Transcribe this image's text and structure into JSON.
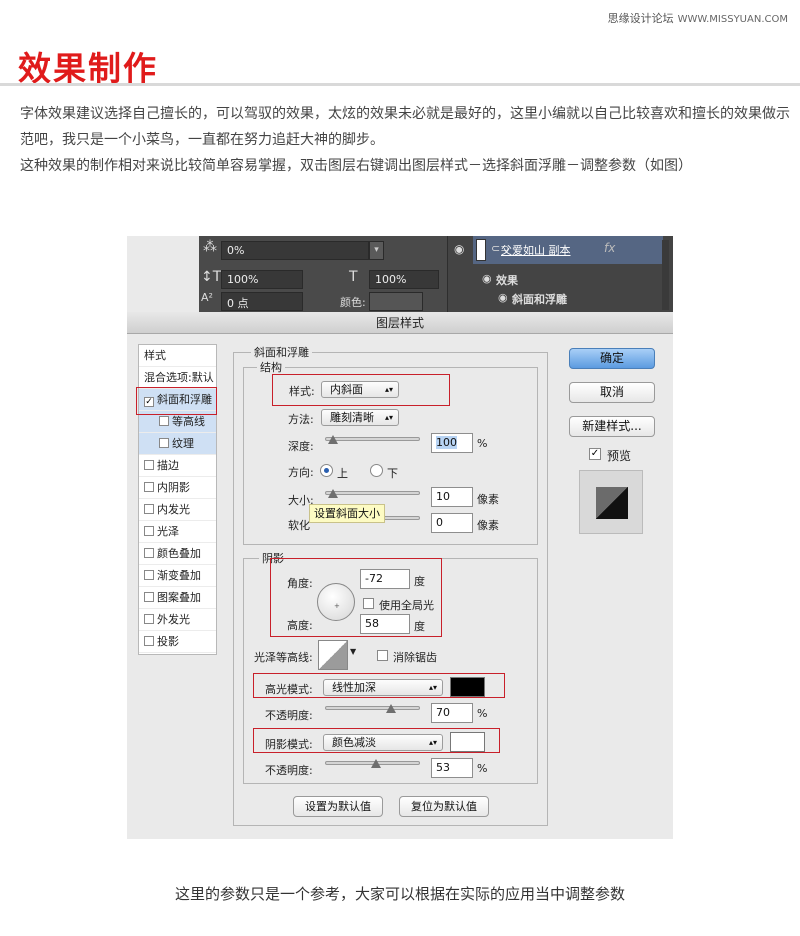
{
  "header": {
    "site_name": "思缘设计论坛",
    "site_url": "WWW.MISSYUAN.COM",
    "title": "效果制作"
  },
  "intro": {
    "p1": "字体效果建议选择自己擅长的，可以驾驭的效果，太炫的效果未必就是最好的，这里小编就以自己比较喜欢和擅长的效果做示范吧，我只是一个小菜鸟，一直都在努力追赶大神的脚步。",
    "p2": "这种效果的制作相对来说比较简单容易掌握，双击图层右键调出图层样式－选择斜面浮雕－调整参数（如图）"
  },
  "caption": "这里的参数只是一个参考，大家可以根据在实际的应用当中调整参数",
  "ps_panel": {
    "fill_value": "0%",
    "vertical_scale": "100%",
    "horizontal_scale": "100%",
    "baseline_value": "0 点",
    "color_label": "颜色:",
    "layer_name": "父爱如山 副本",
    "fx_label": "fx",
    "effects_label": "效果",
    "effect_bevel": "斜面和浮雕"
  },
  "dialog": {
    "title": "图层样式",
    "left_items": [
      {
        "label": "样式"
      },
      {
        "label": "混合选项:默认"
      },
      {
        "label": "斜面和浮雕",
        "checked": true
      },
      {
        "label": "等高线",
        "checked": false
      },
      {
        "label": "纹理",
        "checked": false
      },
      {
        "label": "描边",
        "checked": false
      },
      {
        "label": "内阴影",
        "checked": false
      },
      {
        "label": "内发光",
        "checked": false
      },
      {
        "label": "光泽",
        "checked": false
      },
      {
        "label": "颜色叠加",
        "checked": false
      },
      {
        "label": "渐变叠加",
        "checked": false
      },
      {
        "label": "图案叠加",
        "checked": false
      },
      {
        "label": "外发光",
        "checked": false
      },
      {
        "label": "投影",
        "checked": false
      }
    ],
    "bevel_group": "斜面和浮雕",
    "structure_group": "结构",
    "style_label": "样式:",
    "style_value": "内斜面",
    "technique_label": "方法:",
    "technique_value": "雕刻清晰",
    "depth_label": "深度:",
    "depth_value": "100",
    "depth_unit": "%",
    "direction_label": "方向:",
    "direction_up": "上",
    "direction_down": "下",
    "size_label": "大小:",
    "size_value": "10",
    "size_unit": "像素",
    "soften_label": "软化",
    "soften_value": "0",
    "soften_unit": "像素",
    "tooltip": "设置斜面大小",
    "shading_group": "阴影",
    "angle_label": "角度:",
    "angle_value": "-72",
    "angle_unit": "度",
    "global_light_label": "使用全局光",
    "altitude_label": "高度:",
    "altitude_value": "58",
    "altitude_unit": "度",
    "gloss_contour_label": "光泽等高线:",
    "antialias_label": "消除锯齿",
    "highlight_mode_label": "高光模式:",
    "highlight_mode_value": "线性加深",
    "highlight_opacity_label": "不透明度:",
    "highlight_opacity_value": "70",
    "highlight_opacity_unit": "%",
    "shadow_mode_label": "阴影模式:",
    "shadow_mode_value": "颜色减淡",
    "shadow_opacity_label": "不透明度:",
    "shadow_opacity_value": "53",
    "shadow_opacity_unit": "%",
    "make_default": "设置为默认值",
    "reset_default": "复位为默认值",
    "ok": "确定",
    "cancel": "取消",
    "new_style": "新建样式...",
    "preview_label": "预览",
    "colors": {
      "highlight": "#000000",
      "shadow": "#ffffff",
      "primary_button": "#5c9be0",
      "annotation_box": "#c8202a"
    }
  }
}
